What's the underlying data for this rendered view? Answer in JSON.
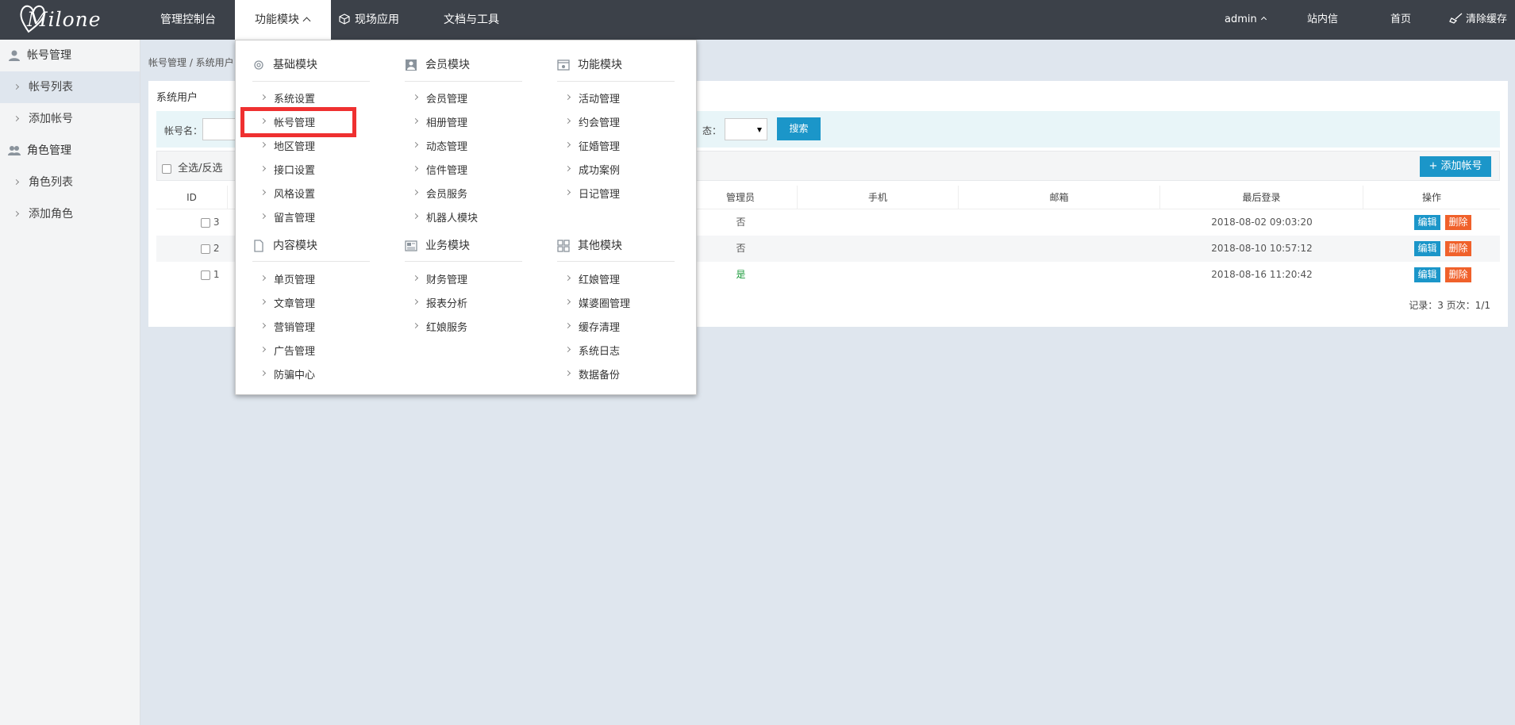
{
  "app": {
    "logo_text": "Milone"
  },
  "topnav": {
    "items": [
      {
        "label": "管理控制台"
      },
      {
        "label": "功能模块"
      },
      {
        "label": "现场应用"
      },
      {
        "label": "文档与工具"
      }
    ],
    "right": {
      "user": "admin",
      "messages": "站内信",
      "home": "首页",
      "clear_cache": "清除缓存"
    }
  },
  "sidebar": {
    "groups": [
      {
        "label": "帐号管理",
        "items": [
          {
            "label": "帐号列表"
          },
          {
            "label": "添加帐号"
          }
        ]
      },
      {
        "label": "角色管理",
        "items": [
          {
            "label": "角色列表"
          },
          {
            "label": "添加角色"
          }
        ]
      }
    ]
  },
  "breadcrumb": "帐号管理 / 系统用户",
  "panel": {
    "title": "系统用户",
    "search": {
      "account_label": "帐号名：",
      "status_label": "态：",
      "status_value": "",
      "search_button": "搜索"
    },
    "toolbar": {
      "select_all": "全选/反选",
      "add_button": "+ 添加帐号"
    },
    "columns": {
      "id": "ID",
      "admin": "管理员",
      "phone": "手机",
      "email": "邮箱",
      "last_login": "最后登录",
      "actions": "操作"
    },
    "rows": [
      {
        "id": "3",
        "admin": "否",
        "phone": "",
        "email": "",
        "last_login": "2018-08-02 09:03:20",
        "edit": "编辑",
        "delete": "删除"
      },
      {
        "id": "2",
        "admin": "否",
        "phone": "",
        "email": "",
        "last_login": "2018-08-10 10:57:12",
        "edit": "编辑",
        "delete": "删除"
      },
      {
        "id": "1",
        "admin": "是",
        "phone": "",
        "email": "",
        "last_login": "2018-08-16 11:20:42",
        "edit": "编辑",
        "delete": "删除"
      }
    ],
    "pager": "记录：3  页次：1/1"
  },
  "mega_menu": {
    "sections": [
      {
        "title": "基础模块",
        "icon": "gear-icon",
        "items": [
          "系统设置",
          "帐号管理",
          "地区管理",
          "接口设置",
          "风格设置",
          "留言管理"
        ]
      },
      {
        "title": "会员模块",
        "icon": "user-card-icon",
        "items": [
          "会员管理",
          "相册管理",
          "动态管理",
          "信件管理",
          "会员服务",
          "机器人模块"
        ]
      },
      {
        "title": "功能模块",
        "icon": "window-icon",
        "items": [
          "活动管理",
          "约会管理",
          "征婚管理",
          "成功案例",
          "日记管理"
        ]
      },
      {
        "title": "内容模块",
        "icon": "document-icon",
        "items": [
          "单页管理",
          "文章管理",
          "营销管理",
          "广告管理",
          "防骗中心"
        ]
      },
      {
        "title": "业务模块",
        "icon": "newspaper-icon",
        "items": [
          "财务管理",
          "报表分析",
          "红娘服务"
        ]
      },
      {
        "title": "其他模块",
        "icon": "grid-icon",
        "items": [
          "红娘管理",
          "媒婆圈管理",
          "缓存清理",
          "系统日志",
          "数据备份"
        ]
      }
    ],
    "highlighted_item": "帐号管理"
  },
  "colors": {
    "topbar": "#3c4149",
    "primary": "#1b96c9",
    "danger": "#f0612b",
    "highlight": "#ef3030"
  }
}
